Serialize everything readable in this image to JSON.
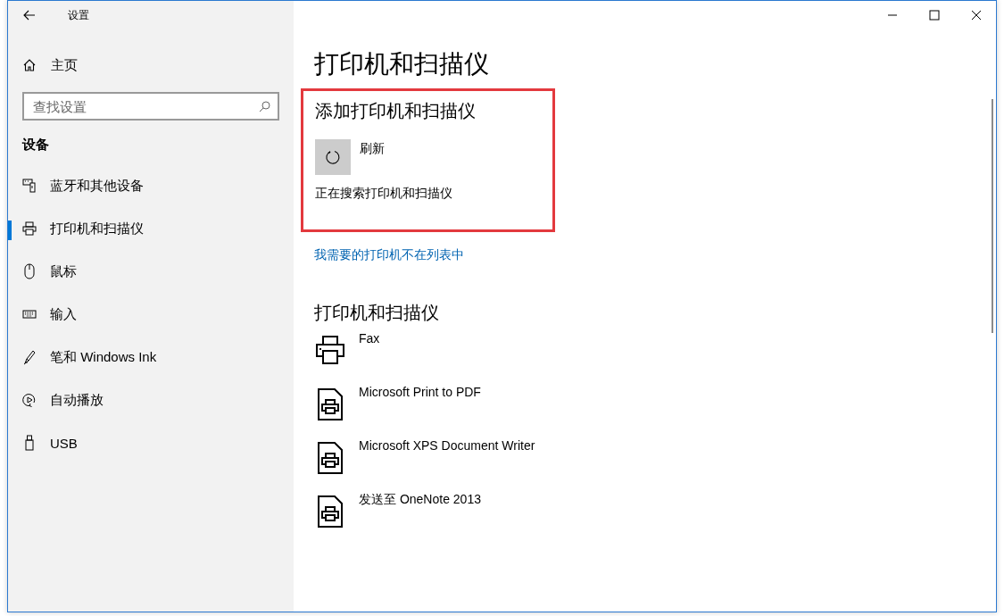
{
  "window": {
    "title": "设置"
  },
  "sidebar": {
    "home": "主页",
    "search": {
      "placeholder": "查找设置"
    },
    "section": "设备",
    "items": [
      {
        "label": "蓝牙和其他设备",
        "selected": false
      },
      {
        "label": "打印机和扫描仪",
        "selected": true
      },
      {
        "label": "鼠标",
        "selected": false
      },
      {
        "label": "输入",
        "selected": false
      },
      {
        "label": "笔和 Windows Ink",
        "selected": false
      },
      {
        "label": "自动播放",
        "selected": false
      },
      {
        "label": "USB",
        "selected": false
      }
    ]
  },
  "main": {
    "title": "打印机和扫描仪",
    "add_section": {
      "heading": "添加打印机和扫描仪",
      "refresh": "刷新",
      "status": "正在搜索打印机和扫描仪"
    },
    "link": "我需要的打印机不在列表中",
    "list_heading": "打印机和扫描仪",
    "printers": [
      {
        "name": "Fax",
        "kind": "fax"
      },
      {
        "name": "Microsoft Print to PDF",
        "kind": "file"
      },
      {
        "name": "Microsoft XPS Document Writer",
        "kind": "file"
      },
      {
        "name": "发送至 OneNote 2013",
        "kind": "file"
      }
    ]
  }
}
